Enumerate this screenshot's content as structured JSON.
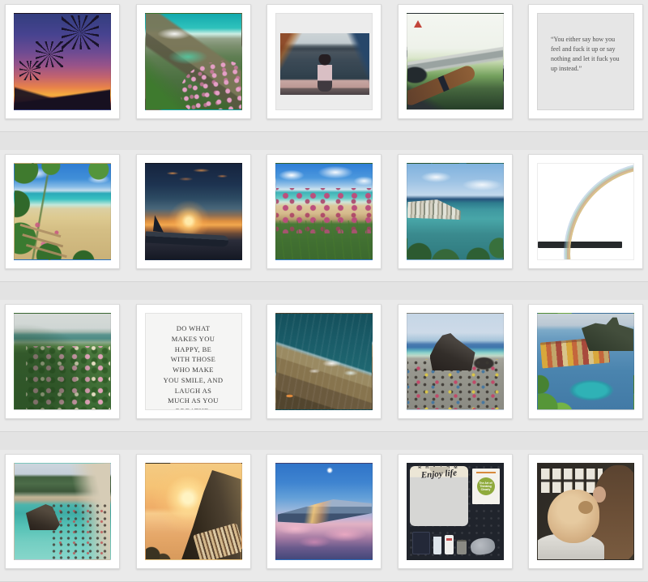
{
  "page": {
    "name": "photo-grid-gallery"
  },
  "colors": {
    "page_background": "#e3e3e3",
    "band_background": "#eaeaea",
    "row_divider": "#d5d5d5",
    "card_background": "#ffffff",
    "card_border": "#dadada",
    "quote_text": "#4e4e4e"
  },
  "grid": {
    "rows": 4,
    "cols": 5,
    "tiles": [
      {
        "kind": "photo",
        "name": "sunset-palms",
        "alt": "Palm tree silhouettes against a purple and orange sunset sky"
      },
      {
        "kind": "photo",
        "name": "flower-cove",
        "alt": "Turquoise sea cove with rocks and pink wildflowers"
      },
      {
        "kind": "photo",
        "name": "harbor-overlook",
        "alt": "Woman leaning on a railing overlooking a harbor with boats and a blue headland"
      },
      {
        "kind": "photo",
        "name": "car-window-arm",
        "alt": "Arm with a wristwatch reaching out of a car window past a guardrail and greenery"
      },
      {
        "kind": "quote",
        "name": "quote-card-1",
        "text": "“You either say how you feel and fuck it up or say nothing and let it fuck you up instead.”"
      },
      {
        "kind": "photo",
        "name": "beach-path-fence",
        "alt": "Sandy beach and turquoise sea framed by green leaves with a wooden fence"
      },
      {
        "kind": "photo",
        "name": "airport-sunset",
        "alt": "Airplane silhouette at an airport under an orange and dark blue sunset"
      },
      {
        "kind": "photo",
        "name": "valerian-beach",
        "alt": "Pink valerian flowers in front of a curved sandy bay and blue sky with clouds"
      },
      {
        "kind": "photo",
        "name": "coastal-town",
        "alt": "Coastal town on a green headland beside a teal sea under a cloudy blue sky"
      },
      {
        "kind": "photo",
        "name": "rainbow-harbor",
        "alt": "Rainbow over a harbor breakwater with a small lighthouse and green sea"
      },
      {
        "kind": "photo",
        "name": "rose-bush-coast",
        "alt": "Bush with small pink flowers above a teal sea under an overcast sky"
      },
      {
        "kind": "quote",
        "name": "quote-card-2",
        "text": "DO WHAT\nMAKES YOU\nHAPPY, BE\nWITH THOSE\nWHO MAKE\nYOU SMILE, AND\nLAUGH AS\nMUCH AS YOU\nBREATHE."
      },
      {
        "kind": "photo",
        "name": "rocky-shore-aerial",
        "alt": "Aerial view of waves foaming against brown rocks in deep teal water"
      },
      {
        "kind": "photo",
        "name": "beach-rock-crowd",
        "alt": "Crowded pebble beach with colorful towels beside a large dark rock"
      },
      {
        "kind": "photo",
        "name": "vernazza-harbor",
        "alt": "Colorful seaside village and turquoise harbor seen from above through greenery"
      },
      {
        "kind": "photo",
        "name": "monterosso-beach",
        "alt": "Beach town below green hills with a dark rock in clear turquoise water"
      },
      {
        "kind": "photo",
        "name": "hillside-sunset",
        "alt": "Golden sunset over the sea with a dark hillside village silhouette"
      },
      {
        "kind": "photo",
        "name": "airplane-wing",
        "alt": "Airplane wing over pink clouds at dusk with the moon in a blue sky"
      },
      {
        "kind": "flatlay",
        "name": "travel-flatlay",
        "alt": "Flat lay with sweatshirt, book, passport and toiletries on a dark background",
        "sweatshirt_top": "R H Y T H M",
        "sweatshirt_script": "Enjoy life",
        "book_title": "The Art of Thinking Clearly"
      },
      {
        "kind": "photo",
        "name": "girl-with-dog",
        "alt": "Girl with long brown hair hugging a fluffy cream dog in front of a polaroid wall"
      }
    ]
  }
}
